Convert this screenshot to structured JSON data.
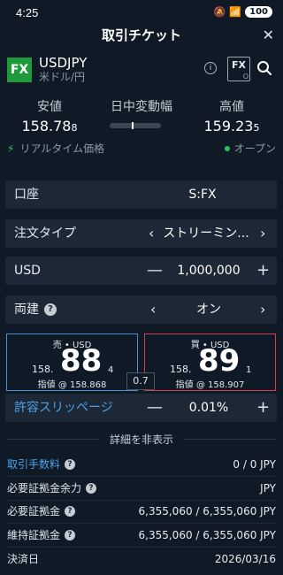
{
  "status_bar": {
    "time": "4:25",
    "battery": "100"
  },
  "header": {
    "title": "取引チケット",
    "close": "✕"
  },
  "symbol": {
    "badge": "FX",
    "name": "USDJPY",
    "subtitle": "米ドル/円",
    "chip": "FX",
    "chip_sub": "O"
  },
  "summary": {
    "low_label": "安値",
    "low_main": "158.78",
    "low_tail": "8",
    "range_label": "日中変動幅",
    "high_label": "高値",
    "high_main": "159.23",
    "high_tail": "5"
  },
  "realtime": {
    "label": "リアルタイム価格",
    "status": "オープン"
  },
  "form": {
    "account": {
      "label": "口座",
      "value": "S:FX"
    },
    "order_type": {
      "label": "注文タイプ",
      "value": "ストリーミン..."
    },
    "quantity": {
      "label": "USD",
      "value": "1,000,000",
      "minus": "—",
      "plus": "+"
    },
    "two_way": {
      "label": "両建",
      "value": "オン",
      "help": "?"
    }
  },
  "quotes": {
    "sell": {
      "header": "売 • USD",
      "prefix": "158.",
      "big": "88",
      "tail": "4",
      "limit_text": "指値 @ 158.868"
    },
    "buy": {
      "header": "買 • USD",
      "prefix": "158.",
      "big": "89",
      "tail": "1",
      "limit_text": "指値 @ 158.907"
    },
    "spread": "0.7"
  },
  "slippage": {
    "label": "許容スリッページ",
    "value": "0.01%",
    "minus": "—",
    "plus": "+"
  },
  "details_toggle": "詳細を非表示",
  "details": [
    {
      "label": "取引手数料",
      "value": "0 / 0 JPY",
      "help": "?",
      "link": true
    },
    {
      "label": "必要証拠金余力",
      "value": "JPY",
      "help": "?"
    },
    {
      "label": "必要証拠金",
      "value": "6,355,060 / 6,355,060 JPY",
      "help": "?"
    },
    {
      "label": "維持証拠金",
      "value": "6,355,060 / 6,355,060 JPY",
      "help": "?"
    },
    {
      "label": "決済日",
      "value": "2026/03/16"
    }
  ],
  "colors": {
    "background": "#0f1a26",
    "row": "#1c2836",
    "sell_border": "#4b8fd6",
    "buy_border": "#d0404d",
    "link": "#4ea2e8",
    "fx_badge": "#1e9a3a"
  }
}
